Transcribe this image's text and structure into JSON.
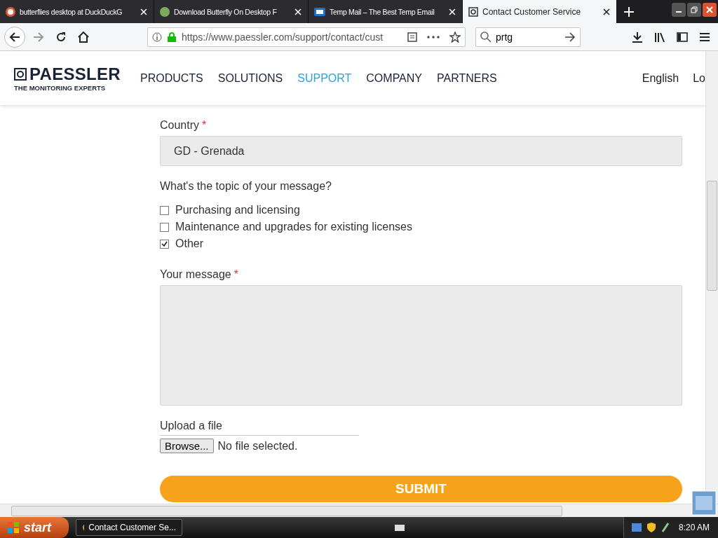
{
  "browser": {
    "tabs": [
      {
        "title": "butterflies desktop at DuckDuckG",
        "selected": false
      },
      {
        "title": "Download Butterfly On Desktop F",
        "selected": false
      },
      {
        "title": "Temp Mail – The Best Temp Email",
        "selected": false
      },
      {
        "title": "Contact Customer Service",
        "selected": true
      }
    ],
    "url": "https://www.paessler.com/support/contact/cust",
    "search": "prtg"
  },
  "site": {
    "logo": {
      "name": "PAESSLER",
      "tagline": "THE MONITORING EXPERTS"
    },
    "nav": [
      {
        "label": "PRODUCTS",
        "selected": false
      },
      {
        "label": "SOLUTIONS",
        "selected": false
      },
      {
        "label": "SUPPORT",
        "selected": true
      },
      {
        "label": "COMPANY",
        "selected": false
      },
      {
        "label": "PARTNERS",
        "selected": false
      }
    ],
    "language": "English",
    "login": "Lo"
  },
  "form": {
    "country": {
      "label": "Country",
      "required_mark": "*",
      "value": "GD - Grenada"
    },
    "topic": {
      "question": "What's the topic of your message?",
      "options": [
        {
          "label": "Purchasing and licensing",
          "checked": false
        },
        {
          "label": "Maintenance and upgrades for existing licenses",
          "checked": false
        },
        {
          "label": "Other",
          "checked": true
        }
      ]
    },
    "message": {
      "label": "Your message",
      "required_mark": "*"
    },
    "upload": {
      "label": "Upload a file",
      "button": "Browse...",
      "status": "No file selected."
    },
    "submit": "SUBMIT"
  },
  "taskbar": {
    "start": "start",
    "windows": [
      {
        "title": "Contact Customer Se...",
        "selected": true
      }
    ],
    "time": "8:20 AM"
  }
}
